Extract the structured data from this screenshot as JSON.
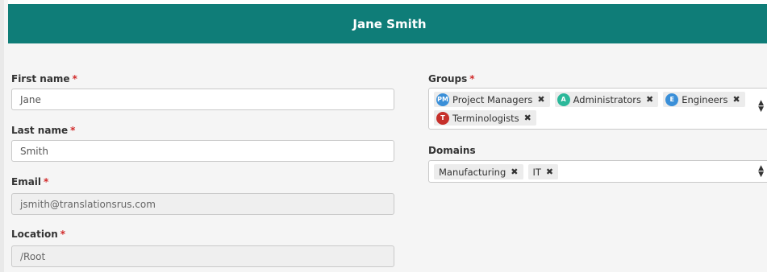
{
  "header": {
    "title": "Jane Smith"
  },
  "form": {
    "first_name": {
      "label": "First name",
      "required": "*",
      "value": "Jane"
    },
    "last_name": {
      "label": "Last name",
      "required": "*",
      "value": "Smith"
    },
    "email": {
      "label": "Email",
      "required": "*",
      "value": "jsmith@translationsrus.com"
    },
    "location": {
      "label": "Location",
      "required": "*",
      "value": "/Root"
    },
    "groups": {
      "label": "Groups",
      "required": "*",
      "items": [
        {
          "initials": "PM",
          "label": "Project Managers",
          "color": "#3a8fd8"
        },
        {
          "initials": "A",
          "label": "Administrators",
          "color": "#2bb89a"
        },
        {
          "initials": "E",
          "label": "Engineers",
          "color": "#3a8fd8"
        },
        {
          "initials": "T",
          "label": "Terminologists",
          "color": "#c6302b"
        }
      ]
    },
    "domains": {
      "label": "Domains",
      "items": [
        {
          "label": "Manufacturing"
        },
        {
          "label": "IT"
        }
      ]
    },
    "remove_glyph": "✖",
    "caret_up": "▲",
    "caret_down": "▼"
  },
  "colors": {
    "header_bg": "#0f7d78",
    "required": "#d12a2a"
  }
}
